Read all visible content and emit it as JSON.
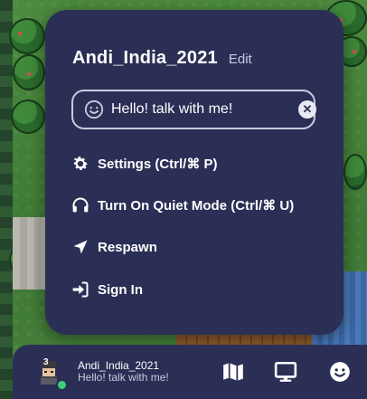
{
  "popup": {
    "username": "Andi_India_2021",
    "edit_label": "Edit",
    "status_value": "Hello! talk with me!",
    "status_icon": "smile-icon",
    "clear_icon": "close-icon",
    "menu": [
      {
        "label": "Settings (Ctrl/⌘ P)",
        "icon": "gear-icon"
      },
      {
        "label": "Turn On Quiet Mode (Ctrl/⌘ U)",
        "icon": "headphones-icon"
      },
      {
        "label": "Respawn",
        "icon": "location-arrow-icon"
      },
      {
        "label": "Sign In",
        "icon": "sign-in-icon"
      }
    ]
  },
  "bottom_bar": {
    "avatar_count": "3",
    "name": "Andi_India_2021",
    "status": "Hello! talk with me!",
    "icons": [
      "map-icon",
      "screen-share-icon",
      "emoji-icon"
    ]
  },
  "colors": {
    "panel": "#2b2f55",
    "text": "#ffffff",
    "muted": "#c9cbe0",
    "online": "#3ad07a"
  }
}
